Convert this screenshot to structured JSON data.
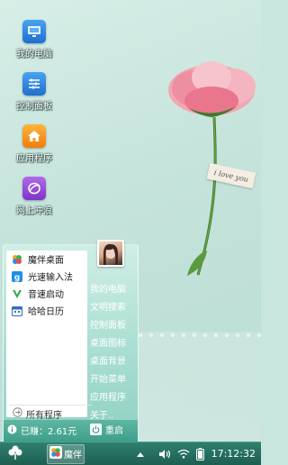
{
  "desktop": {
    "icons": [
      {
        "label": "我的电脑"
      },
      {
        "label": "控制面板"
      },
      {
        "label": "应用程序"
      },
      {
        "label": "网上冲浪"
      }
    ],
    "tag_text": "i love you"
  },
  "start_menu": {
    "programs": [
      {
        "label": "魔伴桌面"
      },
      {
        "label": "光速输入法"
      },
      {
        "label": "音速启动"
      },
      {
        "label": "哈哈日历"
      }
    ],
    "all_programs": "所有程序",
    "right_items": [
      "我的电脑",
      "文明搜索",
      "控制面板",
      "桌面图标",
      "桌面背景",
      "开始菜单",
      "应用程序",
      "关于.."
    ],
    "earned": "已赚：2.61元",
    "restart": "重启"
  },
  "taskbar": {
    "task_label": "魔伴",
    "clock": "17:12:32"
  },
  "colors": {
    "accent": "#3c9d88",
    "taskbar": "#1d5f52"
  }
}
